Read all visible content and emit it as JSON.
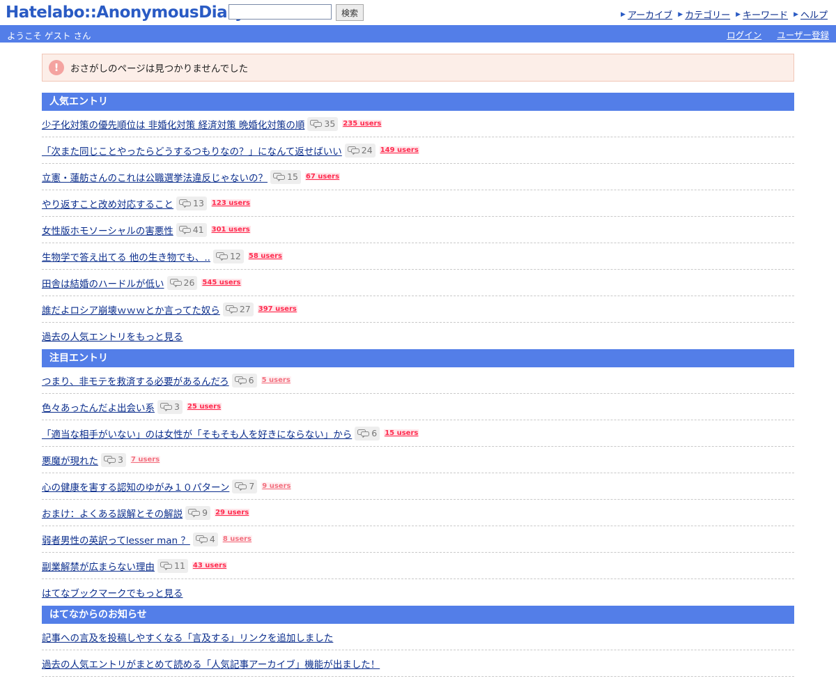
{
  "header": {
    "logo_text": "Hatelabo::AnonymousDiary",
    "search_placeholder": "",
    "search_button": "検索",
    "nav": [
      {
        "label": "アーカイブ"
      },
      {
        "label": "カテゴリー"
      },
      {
        "label": "キーワード"
      },
      {
        "label": "ヘルプ"
      }
    ]
  },
  "bar": {
    "welcome": "ようこそ ゲスト さん",
    "login": "ログイン",
    "register": "ユーザー登録"
  },
  "alert": {
    "icon": "!",
    "message": "おさがしのページは見つかりませんでした"
  },
  "popular": {
    "heading": "人気エントリ",
    "items": [
      {
        "title": "少子化対策の優先順位は 非婚化対策 経済対策 晩婚化対策の順",
        "comments": "35",
        "users": "235 users"
      },
      {
        "title": "「次また同じことやったらどうするつもりなの？」になんて返せばいい",
        "comments": "24",
        "users": "149 users"
      },
      {
        "title": "立憲・蓮舫さんのこれは公職選挙法違反じゃないの？",
        "comments": "15",
        "users": "67 users"
      },
      {
        "title": "やり返すこと改め対応すること",
        "comments": "13",
        "users": "123 users"
      },
      {
        "title": "女性版ホモソーシャルの害悪性",
        "comments": "41",
        "users": "301 users"
      },
      {
        "title": "生物学で答え出てる 他の生き物でも、..",
        "comments": "12",
        "users": "58 users"
      },
      {
        "title": "田舎は結婚のハードルが低い",
        "comments": "26",
        "users": "545 users"
      },
      {
        "title": "誰だよロシア崩壊ｗｗｗとか言ってた奴ら",
        "comments": "27",
        "users": "397 users"
      }
    ],
    "more": "過去の人気エントリをもっと見る"
  },
  "notable": {
    "heading": "注目エントリ",
    "items": [
      {
        "title": "つまり、非モテを救済する必要があるんだろ",
        "comments": "6",
        "users": "5 users",
        "light": true
      },
      {
        "title": "色々あったんだよ出会い系",
        "comments": "3",
        "users": "25 users",
        "light": false
      },
      {
        "title": "「適当な相手がいない」のは女性が「そもそも人を好きにならない」から",
        "comments": "6",
        "users": "15 users",
        "light": false
      },
      {
        "title": "悪魔が現れた",
        "comments": "3",
        "users": "7 users",
        "light": true
      },
      {
        "title": "心の健康を害する認知のゆがみ１０パターン",
        "comments": "7",
        "users": "9 users",
        "light": true
      },
      {
        "title": "おまけ：よくある誤解とその解説",
        "comments": "9",
        "users": "29 users",
        "light": false
      },
      {
        "title": "弱者男性の英訳ってlesser man ？",
        "comments": "4",
        "users": "8 users",
        "light": true
      },
      {
        "title": "副業解禁が広まらない理由",
        "comments": "11",
        "users": "43 users",
        "light": false
      }
    ],
    "more": "はてなブックマークでもっと見る"
  },
  "news": {
    "heading": "はてなからのお知らせ",
    "items": [
      {
        "title": "記事への言及を投稿しやすくなる「言及する」リンクを追加しました"
      },
      {
        "title": "過去の人気エントリがまとめて読める「人気記事アーカイブ」機能が出ました！"
      }
    ]
  }
}
